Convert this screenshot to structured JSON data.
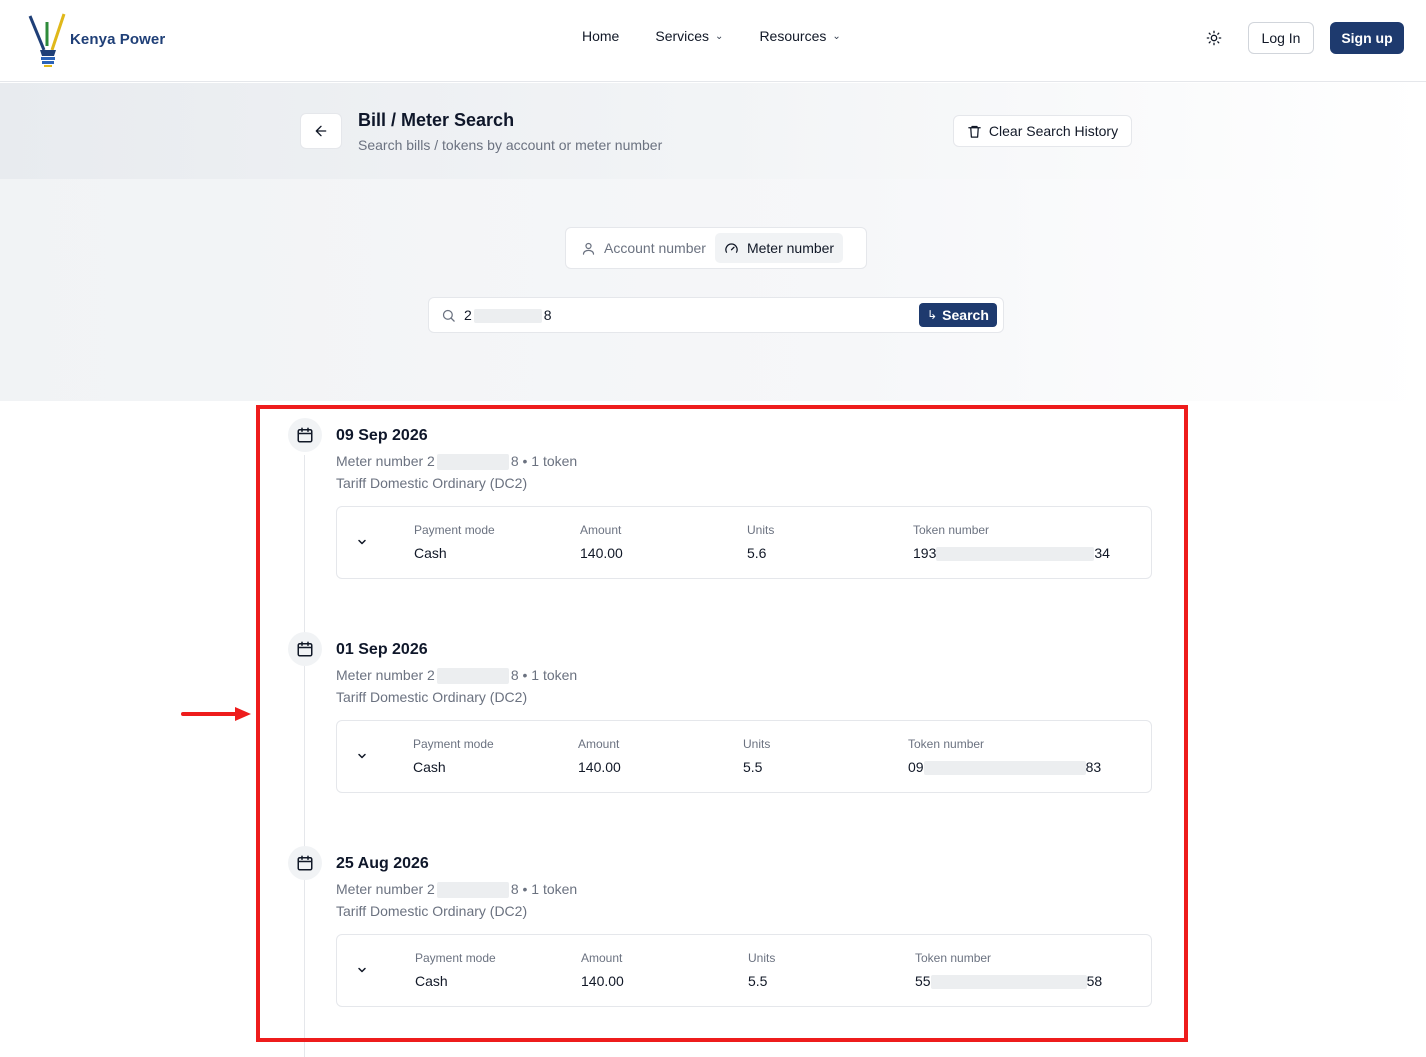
{
  "nav": {
    "brand": "Kenya Power",
    "links": [
      {
        "label": "Home",
        "has_dropdown": false
      },
      {
        "label": "Services",
        "has_dropdown": true
      },
      {
        "label": "Resources",
        "has_dropdown": true
      }
    ],
    "theme_icon": "sun-icon",
    "login_label": "Log In",
    "signup_label": "Sign up"
  },
  "header": {
    "title": "Bill / Meter Search",
    "subtitle": "Search bills / tokens by account or meter number",
    "clear_label": "Clear Search History"
  },
  "search": {
    "modes": [
      {
        "label": "Account number",
        "icon": "user-icon",
        "active": false
      },
      {
        "label": "Meter number",
        "icon": "gauge-icon",
        "active": true
      }
    ],
    "query_prefix": "2",
    "query_suffix": "8",
    "button_label": "Search"
  },
  "results": [
    {
      "date": "09 Sep 2026",
      "meter_prefix": "Meter number 2",
      "meter_suffix": "8 • 1 token",
      "tariff": "Tariff Domestic Ordinary (DC2)",
      "payment_mode_label": "Payment mode",
      "payment_mode": "Cash",
      "amount_label": "Amount",
      "amount": "140.00",
      "units_label": "Units",
      "units": "5.6",
      "token_label": "Token number",
      "token_prefix": "193",
      "token_suffix": "34"
    },
    {
      "date": "01 Sep 2026",
      "meter_prefix": "Meter number 2",
      "meter_suffix": "8 • 1 token",
      "tariff": "Tariff Domestic Ordinary (DC2)",
      "payment_mode_label": "Payment mode",
      "payment_mode": "Cash",
      "amount_label": "Amount",
      "amount": "140.00",
      "units_label": "Units",
      "units": "5.5",
      "token_label": "Token number",
      "token_prefix": "09",
      "token_suffix": "83"
    },
    {
      "date": "25 Aug 2026",
      "meter_prefix": "Meter number 2",
      "meter_suffix": "8 • 1 token",
      "tariff": "Tariff Domestic Ordinary (DC2)",
      "payment_mode_label": "Payment mode",
      "payment_mode": "Cash",
      "amount_label": "Amount",
      "amount": "140.00",
      "units_label": "Units",
      "units": "5.5",
      "token_label": "Token number",
      "token_prefix": "55",
      "token_suffix": "58"
    }
  ],
  "colors": {
    "primary": "#1e3a6e",
    "highlight": "#ee1c1c"
  }
}
